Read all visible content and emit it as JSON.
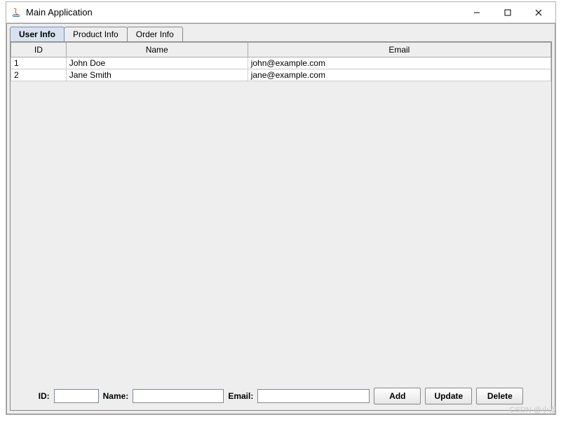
{
  "window": {
    "title": "Main Application"
  },
  "tabs": [
    {
      "label": "User Info",
      "active": true
    },
    {
      "label": "Product Info",
      "active": false
    },
    {
      "label": "Order Info",
      "active": false
    }
  ],
  "table": {
    "columns": [
      "ID",
      "Name",
      "Email"
    ],
    "rows": [
      {
        "id": "1",
        "name": "John Doe",
        "email": "john@example.com"
      },
      {
        "id": "2",
        "name": "Jane Smith",
        "email": "jane@example.com"
      }
    ]
  },
  "form": {
    "id_label": "ID:",
    "id_value": "",
    "name_label": "Name:",
    "name_value": "",
    "email_label": "Email:",
    "email_value": "",
    "add_label": "Add",
    "update_label": "Update",
    "delete_label": "Delete"
  },
  "watermark": "CSDN @小龙"
}
